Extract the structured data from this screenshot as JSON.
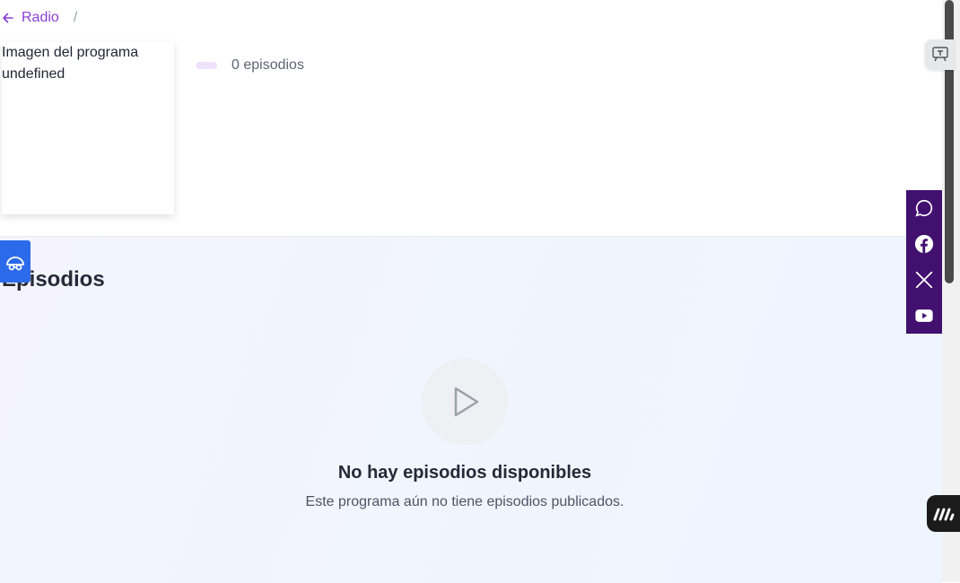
{
  "breadcrumb": {
    "back_label": "Radio",
    "separator": "/"
  },
  "program": {
    "image_alt": "Imagen del programa undefined",
    "episode_count": "0 episodios"
  },
  "episodes_section": {
    "title": "Episodios",
    "empty_title": "No hay episodios disponibles",
    "empty_subtitle": "Este programa aún no tiene episodios publicados."
  },
  "social": [
    "whatsapp-icon",
    "facebook-icon",
    "x-icon",
    "youtube-icon"
  ],
  "colors": {
    "accent_purple": "#8a3fd6",
    "social_bar": "#42106f",
    "accessibility_button": "#2b6bea"
  }
}
